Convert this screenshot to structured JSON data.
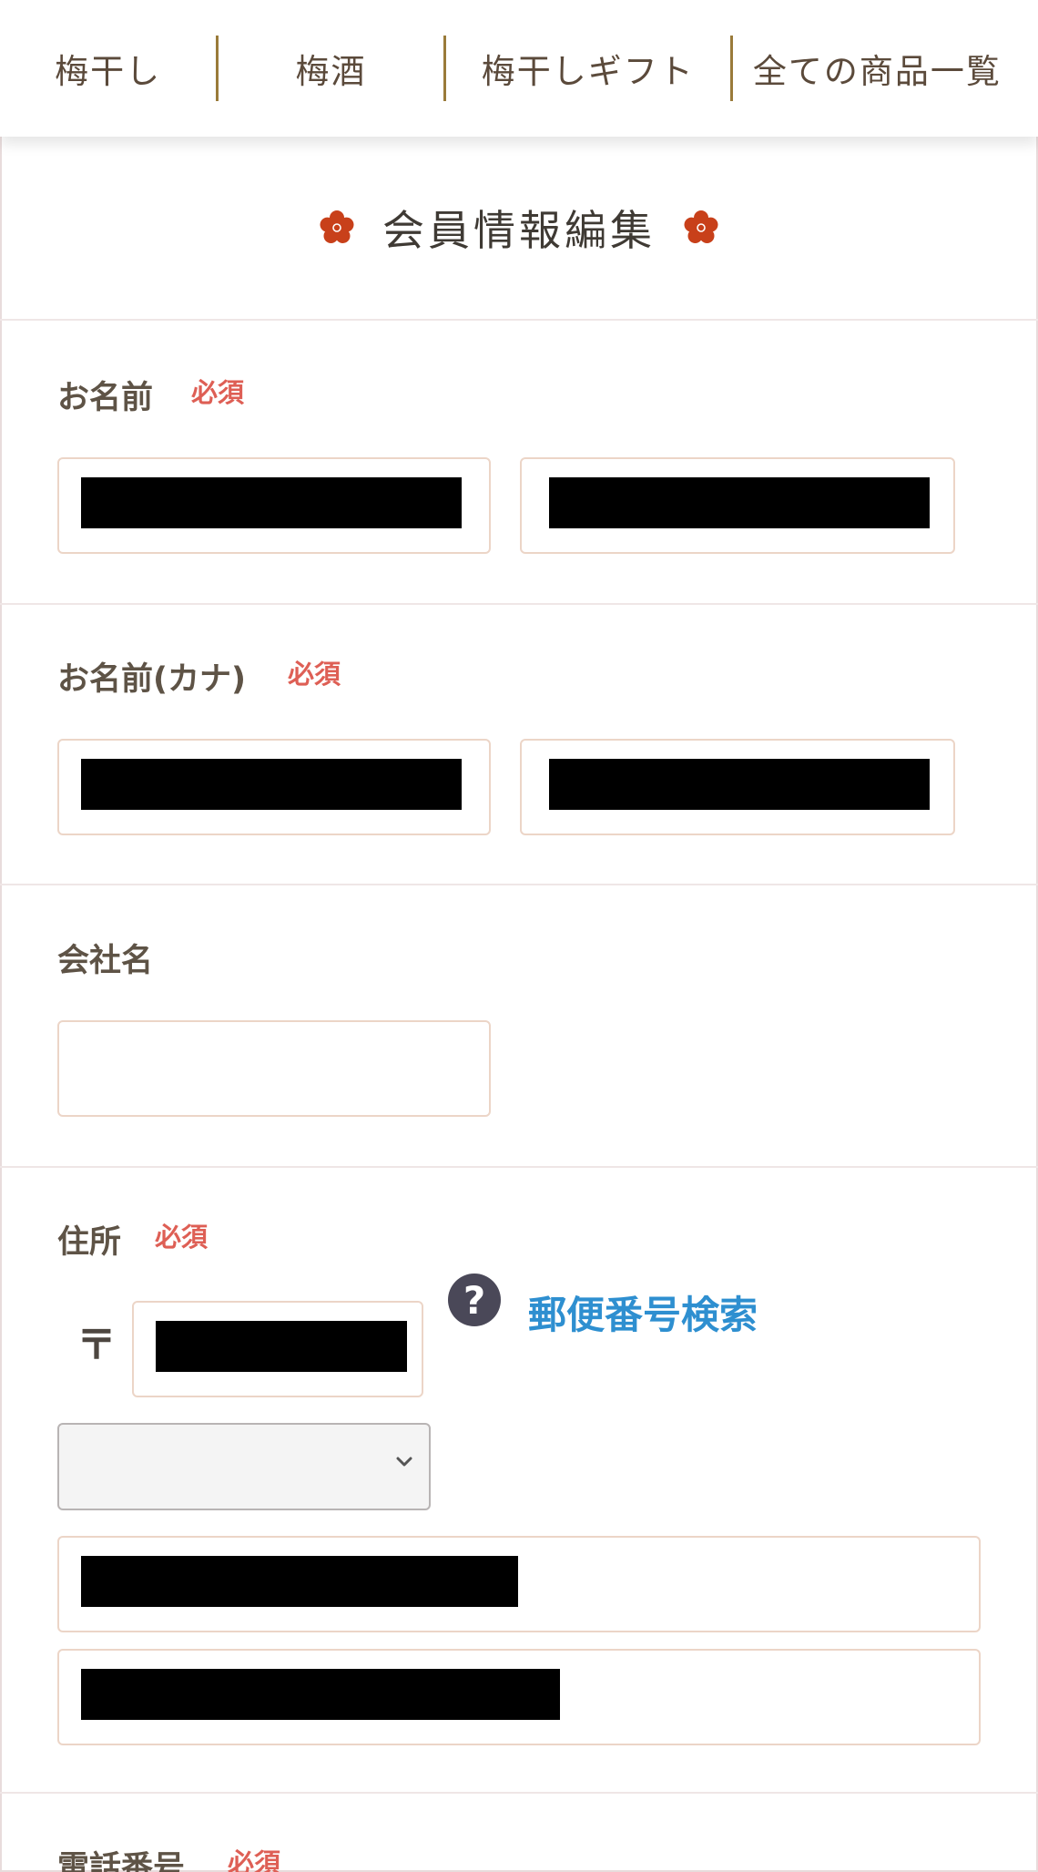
{
  "nav": {
    "items": [
      "梅干し",
      "梅酒",
      "梅干しギフト",
      "全ての商品一覧"
    ]
  },
  "page": {
    "title": "会員情報編集"
  },
  "form": {
    "required_label": "必須",
    "name": {
      "label": "お名前",
      "required": true
    },
    "name_kana": {
      "label": "お名前(カナ)",
      "required": true
    },
    "company": {
      "label": "会社名",
      "value": ""
    },
    "address": {
      "label": "住所",
      "required": true,
      "zip_mark": "〒",
      "help_icon_text": "?",
      "zip_search_link": "郵便番号検索",
      "prefecture_selected": ""
    },
    "phone": {
      "label": "電話番号",
      "required": true
    }
  },
  "colors": {
    "accent_red": "#de5f55",
    "link_blue": "#2e8fd0",
    "nav_separator": "#9a7b3a",
    "plum_icon": "#c8401a",
    "input_border": "#ecd5c7"
  }
}
